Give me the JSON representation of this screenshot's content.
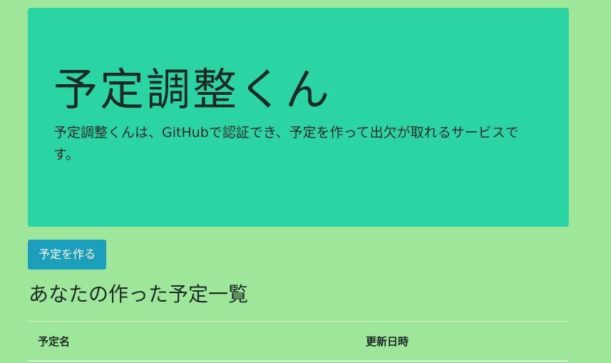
{
  "hero": {
    "title": "予定調整くん",
    "description": "予定調整くんは、GitHubで認証でき、予定を作って出欠が取れるサービスです。"
  },
  "actions": {
    "create_label": "予定を作る"
  },
  "events_section": {
    "title": "あなたの作った予定一覧",
    "columns": [
      "予定名",
      "更新日時"
    ]
  },
  "colors": {
    "page_background": "#9ee79a",
    "hero_background": "#2bd4a3",
    "button_background": "#1b9fbc",
    "button_text": "#ffffff"
  }
}
